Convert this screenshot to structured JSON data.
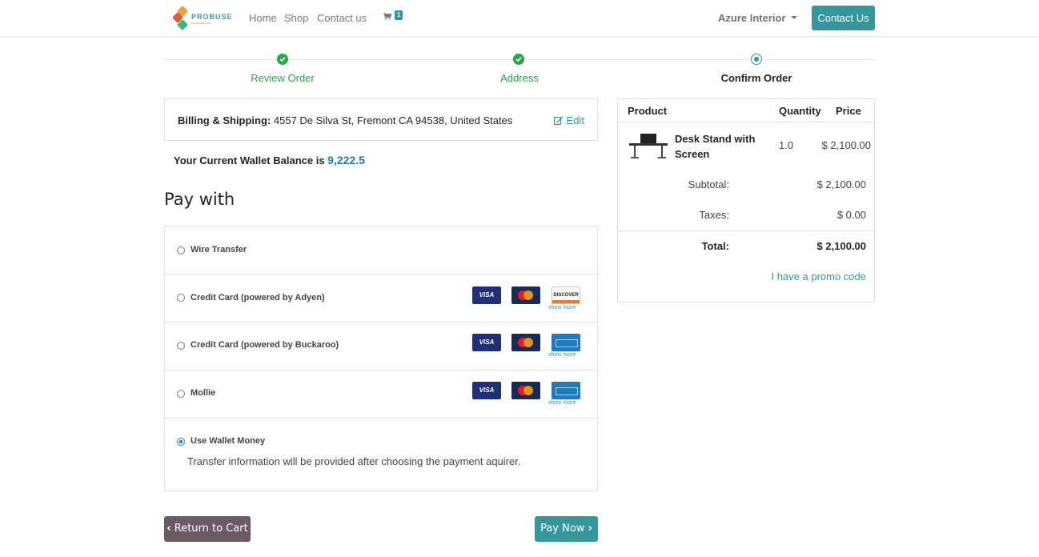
{
  "nav": {
    "brand": "PROBUSE",
    "tagline": "Probuse Business",
    "links": [
      "Home",
      "Shop",
      "Contact us"
    ],
    "cart_count": "1",
    "user": "Azure Interior",
    "contact_button": "Contact Us"
  },
  "steps": [
    {
      "label": "Review Order",
      "state": "done"
    },
    {
      "label": "Address",
      "state": "done"
    },
    {
      "label": "Confirm Order",
      "state": "current"
    }
  ],
  "billing": {
    "label": "Billing & Shipping:",
    "address": "4557 De Silva St, Fremont CA 94538, United States",
    "edit": "Edit"
  },
  "wallet": {
    "label": "Your Current Wallet Balance is",
    "amount": "9,222.5"
  },
  "pay_with_title": "Pay with",
  "payment_methods": [
    {
      "label": "Wire Transfer",
      "cards": [],
      "show_more": ""
    },
    {
      "label": "Credit Card (powered by Adyen)",
      "cards": [
        "VISA",
        "MasterCard",
        "DISCOVER"
      ],
      "show_more": "show more"
    },
    {
      "label": "Credit Card (powered by Buckaroo)",
      "cards": [
        "VISA",
        "MasterCard",
        "AMERICAN EXPRESS"
      ],
      "show_more": "show more"
    },
    {
      "label": "Mollie",
      "cards": [
        "VISA",
        "MasterCard",
        "AMERICAN EXPRESS"
      ],
      "show_more": "show more"
    },
    {
      "label": "Use Wallet Money",
      "checked": true
    }
  ],
  "payment_help": "Transfer information will be provided after choosing the payment aquirer.",
  "buttons": {
    "back": "Return to Cart",
    "pay": "Pay Now"
  },
  "summary": {
    "headers": {
      "product": "Product",
      "quantity": "Quantity",
      "price": "Price"
    },
    "item": {
      "name": "Desk Stand with Screen",
      "quantity": "1.0",
      "price": "$ 2,100.00"
    },
    "subtotal_label": "Subtotal:",
    "subtotal": "$ 2,100.00",
    "taxes_label": "Taxes:",
    "taxes": "$ 0.00",
    "total_label": "Total:",
    "total": "$ 2,100.00",
    "promo": "I have a promo code"
  },
  "colors": {
    "accent": "#35979c",
    "success": "#28a745",
    "back_button": "#6c5b67",
    "wallet_amount": "#1a7bbf"
  }
}
